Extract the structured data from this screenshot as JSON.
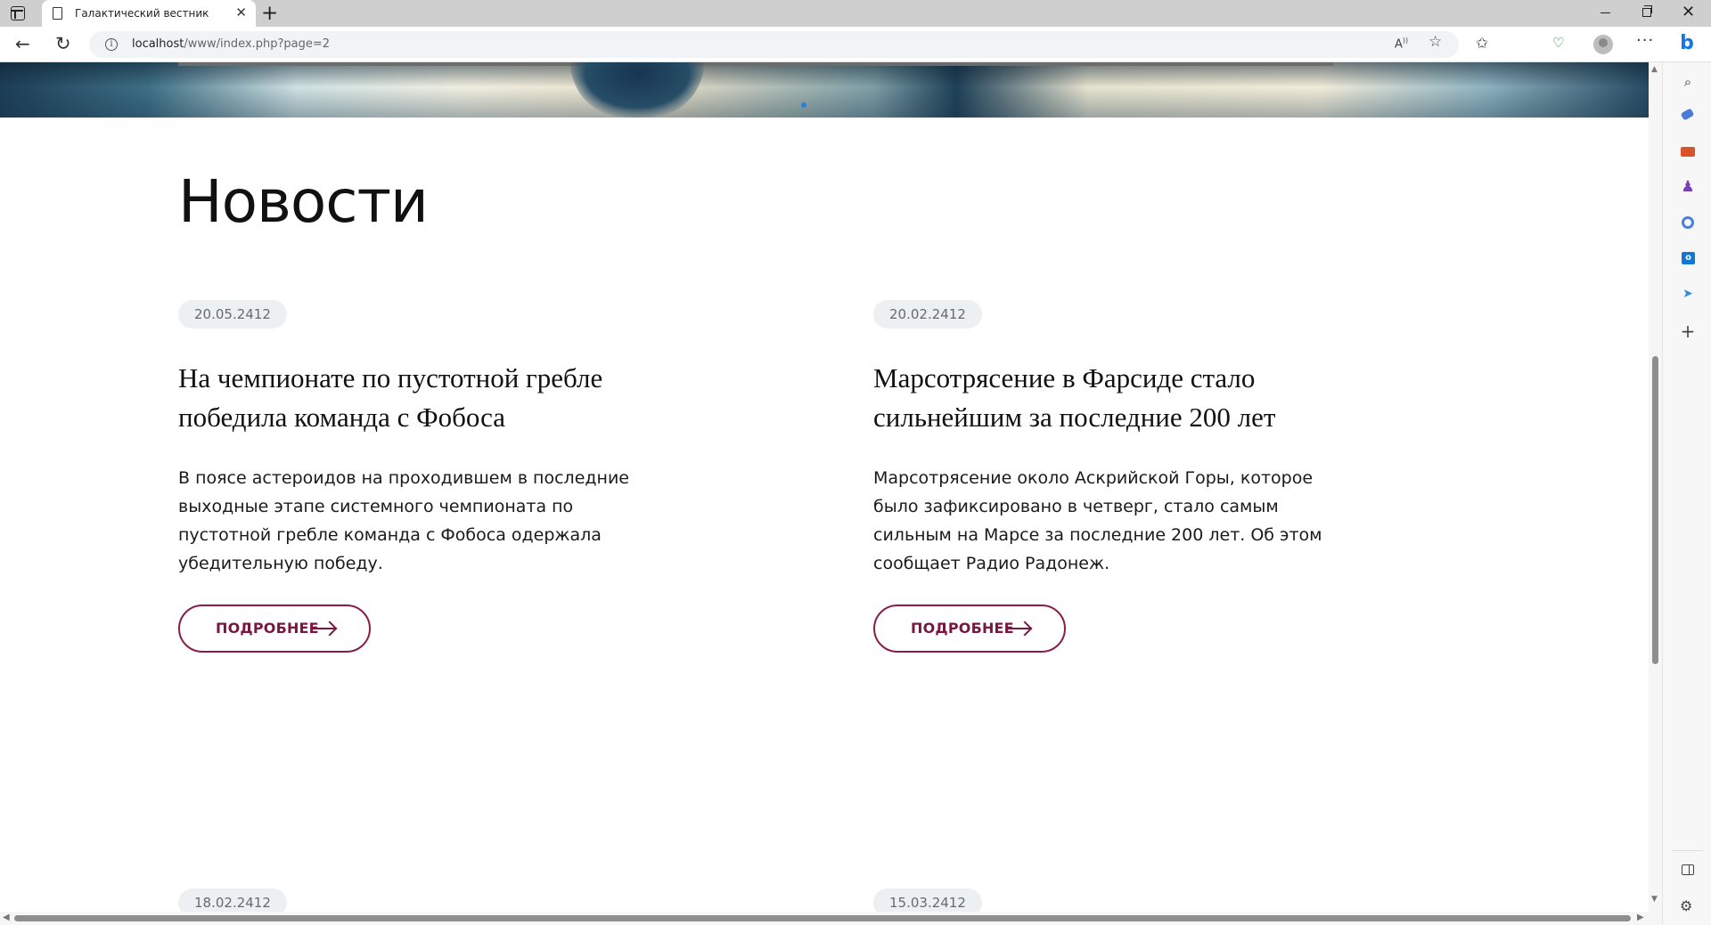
{
  "browser": {
    "tab_title": "Галактический вестник",
    "tab_close": "✕",
    "new_tab": "+",
    "url_host": "localhost",
    "url_path": "/www/index.php?page=2",
    "read_aloud": "Aͅ",
    "icons": [
      "tab-actions-icon",
      "page-icon",
      "back-icon",
      "reload-icon",
      "info-icon",
      "read-aloud-icon",
      "favorite-star-icon",
      "favorites-icon",
      "collections-icon",
      "browser-essentials-icon",
      "profile-icon",
      "more-icon",
      "bing-icon"
    ]
  },
  "sidebar": {
    "icons": [
      "search-icon",
      "shopping-tag-icon",
      "tools-icon",
      "games-icon",
      "microsoft-365-icon",
      "outlook-icon",
      "send-icon",
      "add-icon",
      "sidebar-panel-icon",
      "settings-icon"
    ]
  },
  "page": {
    "section_title": "Новости",
    "more_label": "ПОДРОБНЕЕ",
    "news": [
      {
        "date": "20.05.2412",
        "title": "На чемпионате по пустотной гребле победила команда с Фобоса",
        "excerpt": "В поясе астероидов на проходившем в последние выходные этапе системного чемпионата по пустотной гребле команда с Фобоса одержала убедительную победу."
      },
      {
        "date": "20.02.2412",
        "title": "Марсотрясение в Фарсиде стало сильнейшим за последние 200 лет",
        "excerpt": "Марсотрясение около Аскрийской Горы, которое было зафиксировано в четверг, стало самым сильным на Марсе за последние 200 лет. Об этом сообщает Радио Радонеж."
      },
      {
        "date": "18.02.2412"
      },
      {
        "date": "15.03.2412"
      }
    ]
  },
  "colors": {
    "accent": "#7a1740",
    "date_badge_bg": "#edf0f3",
    "tabbar_bg": "#cfcfcf"
  }
}
